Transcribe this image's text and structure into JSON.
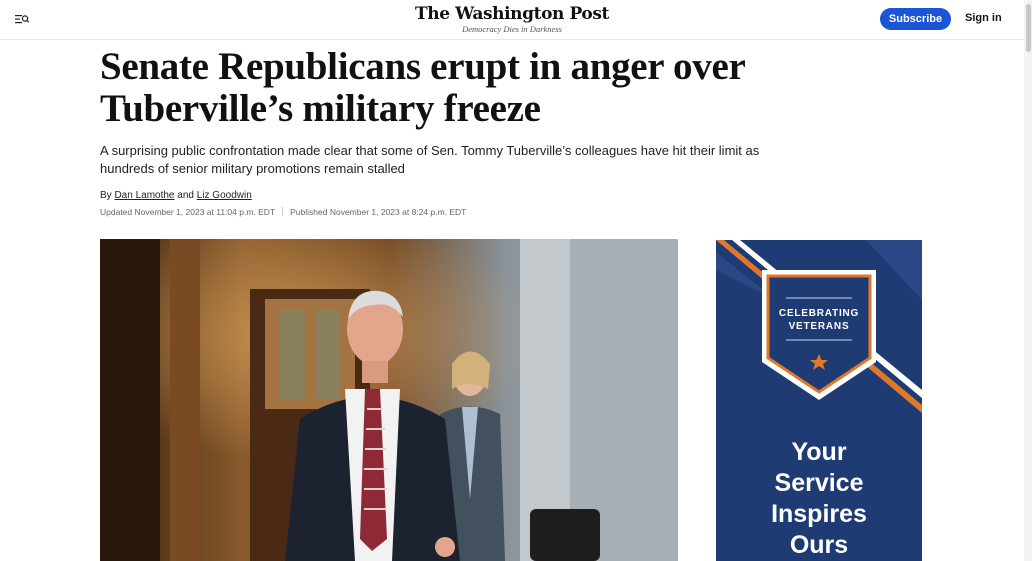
{
  "header": {
    "menu_icon": "menu-search-icon",
    "masthead": "The Washington Post",
    "tagline": "Democracy Dies in Darkness",
    "subscribe_label": "Subscribe",
    "signin_label": "Sign in"
  },
  "article": {
    "headline_line1": "Senate Republicans erupt in anger over",
    "headline_line2": "Tuberville’s military freeze",
    "dek": "A surprising public confrontation made clear that some of Sen. Tommy Tuberville’s colleagues have hit their limit as hundreds of senior military promotions remain stalled",
    "byline_prefix": "By",
    "author1": "Dan Lamothe",
    "byline_and": "and",
    "author2": "Liz Goodwin",
    "updated": "Updated November 1, 2023 at 11:04 p.m. EDT",
    "published": "Published November 1, 2023 at 8:24 p.m. EDT"
  },
  "ad": {
    "badge_line1": "CELEBRATING",
    "badge_line2": "VETERANS",
    "slogan_line1": "Your",
    "slogan_line2": "Service",
    "slogan_line3": "Inspires",
    "slogan_line4": "Ours",
    "colors": {
      "navy": "#1f3b74",
      "orange": "#e0782a"
    }
  },
  "colors": {
    "accent": "#1955d6"
  }
}
